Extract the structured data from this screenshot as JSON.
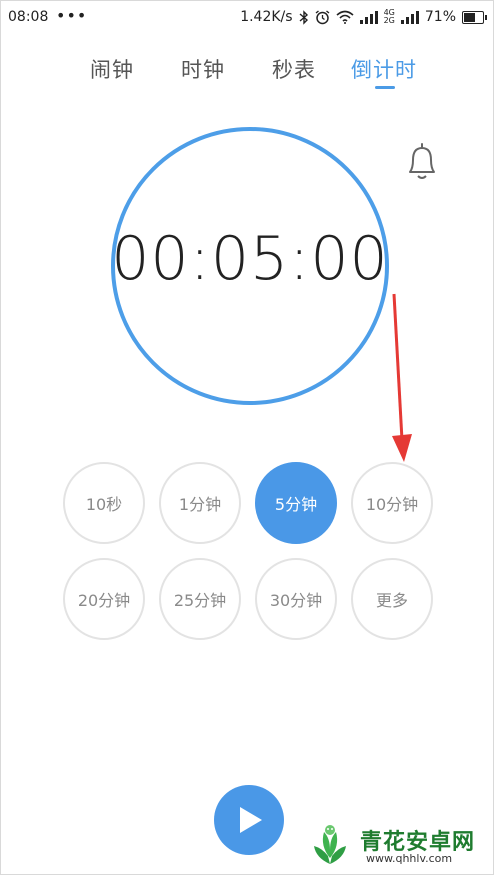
{
  "status_bar": {
    "time": "08:08",
    "dots": "•••",
    "network_speed": "1.42K/s",
    "net_top": "4G",
    "net_bottom": "2G",
    "battery": "71%",
    "battery_level": 0.71
  },
  "tabs": [
    {
      "label": "闹钟"
    },
    {
      "label": "时钟"
    },
    {
      "label": "秒表"
    },
    {
      "label": "倒计时",
      "active": true
    }
  ],
  "timer": {
    "display": "00:05:00"
  },
  "presets": [
    {
      "label": "10秒"
    },
    {
      "label": "1分钟"
    },
    {
      "label": "5分钟",
      "selected": true
    },
    {
      "label": "10分钟"
    },
    {
      "label": "20分钟"
    },
    {
      "label": "25分钟"
    },
    {
      "label": "30分钟"
    },
    {
      "label": "更多"
    }
  ],
  "watermark": {
    "title": "青花安卓网",
    "url": "www.qhhlv.com"
  },
  "colors": {
    "accent": "#4a98e7",
    "arrow": "#e53935",
    "watermark_green": "#1f7c2f"
  },
  "icons": {
    "bell": "bell-icon",
    "play": "play-icon"
  }
}
